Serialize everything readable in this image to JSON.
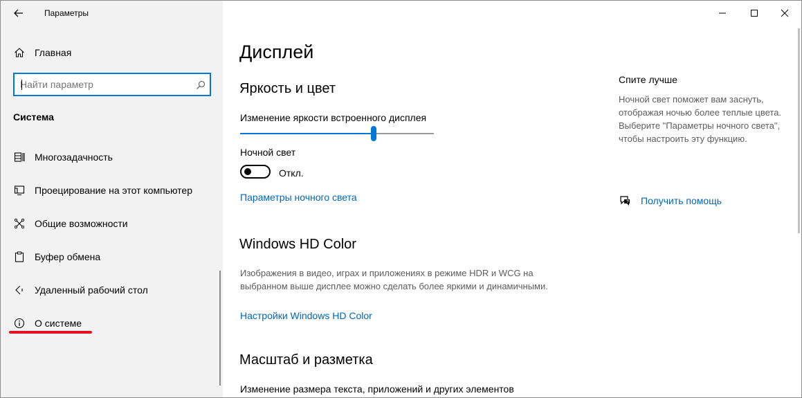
{
  "window": {
    "title": "Параметры",
    "controls": {
      "minimize_icon": "minimize-icon",
      "maximize_icon": "maximize-icon",
      "close_icon": "close-icon"
    }
  },
  "sidebar": {
    "home_label": "Главная",
    "search": {
      "placeholder": "Найти параметр",
      "value": ""
    },
    "section_title": "Система",
    "items": [
      {
        "label": "Многозадачность",
        "icon": "multitasking-icon"
      },
      {
        "label": "Проецирование на этот компьютер",
        "icon": "projecting-icon"
      },
      {
        "label": "Общие возможности",
        "icon": "shared-experiences-icon"
      },
      {
        "label": "Буфер обмена",
        "icon": "clipboard-icon"
      },
      {
        "label": "Удаленный рабочий стол",
        "icon": "remote-desktop-icon"
      },
      {
        "label": "О системе",
        "icon": "info-icon"
      }
    ],
    "highlight_color": "#e81123"
  },
  "main": {
    "title": "Дисплей",
    "brightness": {
      "heading": "Яркость и цвет",
      "slider_label": "Изменение яркости встроенного дисплея",
      "slider_value": 0.69
    },
    "night_light": {
      "label": "Ночной свет",
      "state": "Откл.",
      "on": false,
      "settings_link": "Параметры ночного света"
    },
    "hdr": {
      "heading": "Windows HD Color",
      "description": "Изображения в видео, играх и приложениях в режиме HDR и WCG на выбранном выше дисплее можно сделать более яркими и динамичными.",
      "link": "Настройки Windows HD Color"
    },
    "scale": {
      "heading": "Масштаб и разметка",
      "label": "Изменение размера текста, приложений и других элементов"
    }
  },
  "aside": {
    "heading": "Спите лучше",
    "description": "Ночной свет поможет вам заснуть, отображая ночью более теплые цвета. Выберите \"Параметры ночного света\", чтобы настроить эту функцию.",
    "help_link": "Получить помощь"
  },
  "colors": {
    "accent": "#0078d7",
    "link": "#0067b8",
    "sidebar_bg": "#f2f2f2"
  }
}
